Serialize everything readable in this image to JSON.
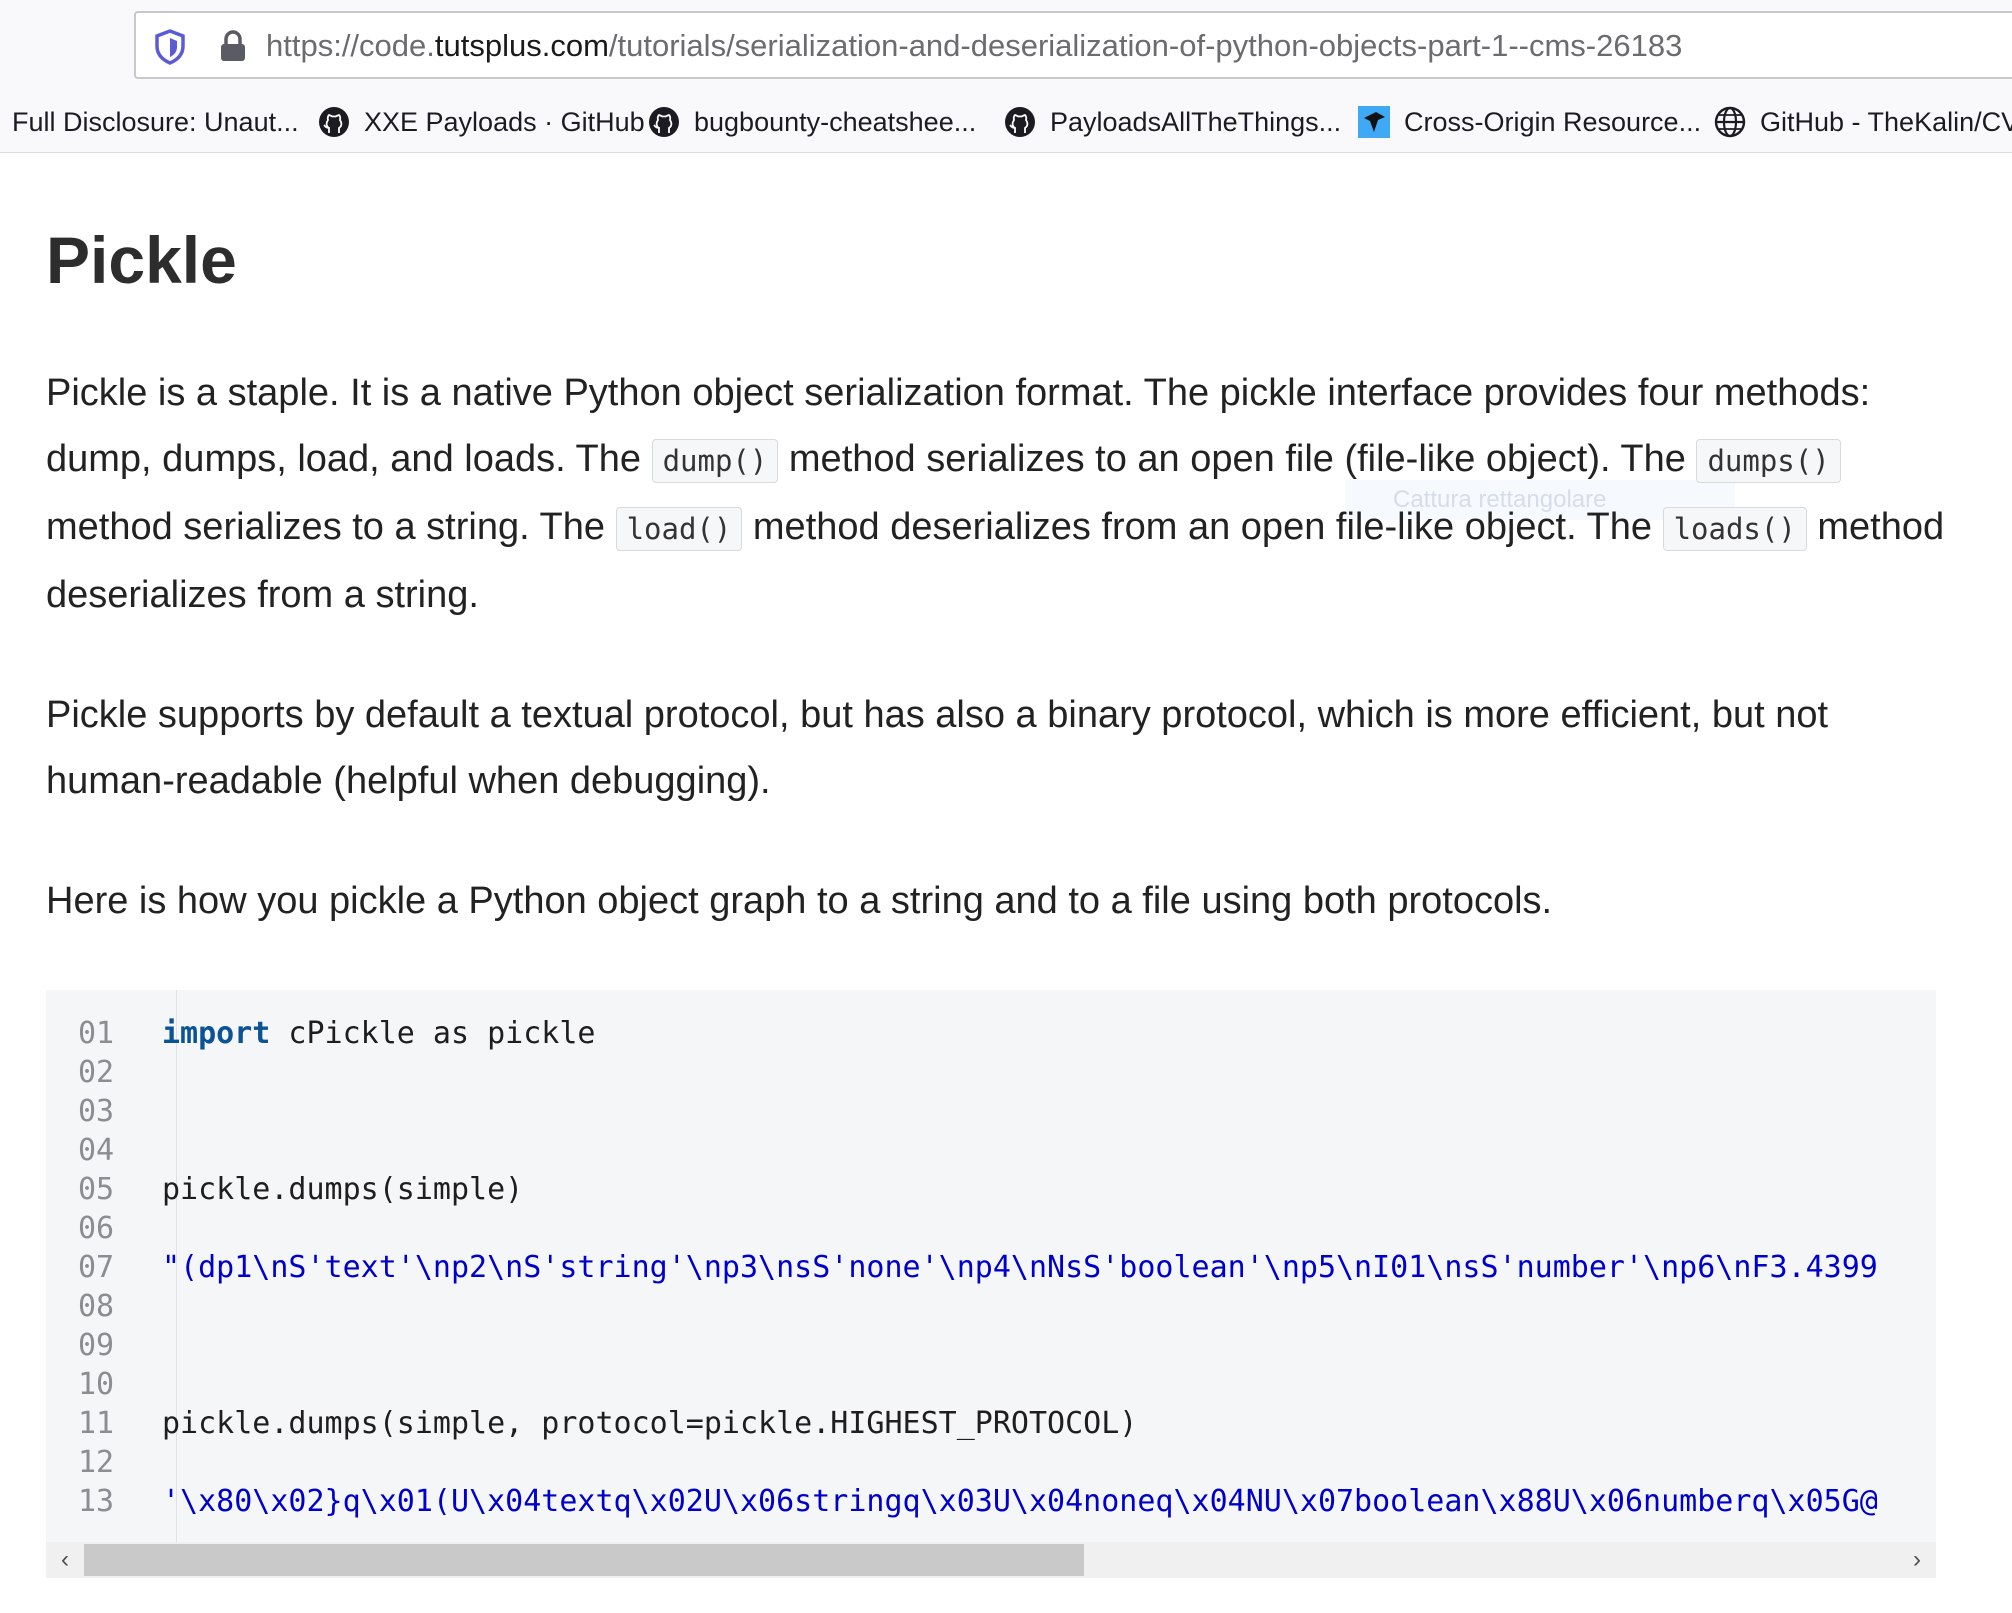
{
  "browser": {
    "url_prefix": "https://code.",
    "url_host": "tutsplus.com",
    "url_path": "/tutorials/serialization-and-deserialization-of-python-objects-part-1--cms-26183",
    "bookmarks": [
      {
        "label": "Full Disclosure: Unaut...",
        "icon": "none"
      },
      {
        "label": "XXE Payloads · GitHub",
        "icon": "github-icon"
      },
      {
        "label": "bugbounty-cheatshee...",
        "icon": "github-icon"
      },
      {
        "label": "PayloadsAllTheThings...",
        "icon": "github-icon"
      },
      {
        "label": "Cross-Origin Resource...",
        "icon": "portswigger-icon"
      },
      {
        "label": "GitHub - TheKalin/CV",
        "icon": "globe-icon"
      }
    ]
  },
  "article": {
    "title": "Pickle",
    "p1": {
      "t1": "Pickle is a staple. It is a native Python object serialization format. The pickle interface provides four methods: dump, dumps, load, and loads. The",
      "c1": "dump()",
      "t2": "method serializes to an open file (file-like object). The",
      "c2": "dumps()",
      "t3": "method serializes to a string. The",
      "c3": "load()",
      "t4": "method deserializes from an open file-like object. The",
      "c4": "loads()",
      "t5": "method deserializes from a string."
    },
    "p2": "Pickle supports by default a textual protocol, but has also a binary protocol, which is more efficient, but not human-readable (helpful when debugging).",
    "p3": "Here is how you pickle a Python object graph to a string and to a file using both protocols.",
    "tooltip_ghost": "Cattura rettangolare"
  },
  "code": {
    "line_numbers": [
      "01",
      "02",
      "03",
      "04",
      "05",
      "06",
      "07",
      "08",
      "09",
      "10",
      "11",
      "12",
      "13"
    ],
    "l1_kw": "import",
    "l1_rest": " cPickle as pickle",
    "l5": "pickle.dumps(simple)",
    "l7": "\"(dp1\\nS'text'\\np2\\nS'string'\\np3\\nsS'none'\\np4\\nNsS'boolean'\\np5\\nI01\\nsS'number'\\np6\\nF3.4399",
    "l11": "pickle.dumps(simple, protocol=pickle.HIGHEST_PROTOCOL)",
    "l13": "'\\x80\\x02}q\\x01(U\\x04textq\\x02U\\x06stringq\\x03U\\x04noneq\\x04NU\\x07boolean\\x88U\\x06numberq\\x05G@"
  },
  "scrollbar": {
    "left_arrow": "‹",
    "right_arrow": "›"
  },
  "colors": {
    "keyword": "#0b5394",
    "string": "#0000cc",
    "code_bg": "#f5f6f8"
  }
}
